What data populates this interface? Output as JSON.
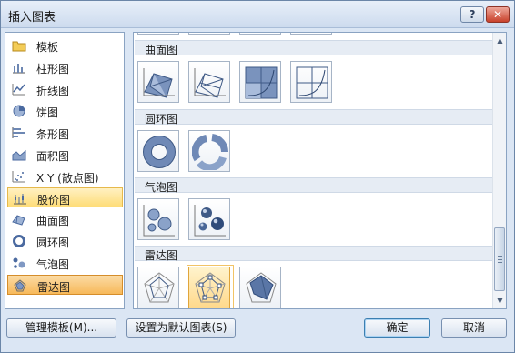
{
  "dialog": {
    "title": "插入图表",
    "help_label": "?",
    "close_label": "✕"
  },
  "categories": [
    {
      "label": "模板",
      "icon": "folder-icon"
    },
    {
      "label": "柱形图",
      "icon": "column-chart-icon"
    },
    {
      "label": "折线图",
      "icon": "line-chart-icon"
    },
    {
      "label": "饼图",
      "icon": "pie-chart-icon"
    },
    {
      "label": "条形图",
      "icon": "bar-chart-icon"
    },
    {
      "label": "面积图",
      "icon": "area-chart-icon"
    },
    {
      "label": "X Y (散点图)",
      "icon": "scatter-chart-icon"
    },
    {
      "label": "股价图",
      "icon": "stock-chart-icon",
      "state": "hover"
    },
    {
      "label": "曲面图",
      "icon": "surface-chart-icon"
    },
    {
      "label": "圆环图",
      "icon": "doughnut-chart-icon"
    },
    {
      "label": "气泡图",
      "icon": "bubble-chart-icon"
    },
    {
      "label": "雷达图",
      "icon": "radar-chart-icon",
      "state": "selected"
    }
  ],
  "sections": [
    {
      "label": "曲面图",
      "thumbs": [
        "3d-surface-icon",
        "wireframe-3d-surface-icon",
        "contour-icon",
        "wireframe-contour-icon"
      ]
    },
    {
      "label": "圆环图",
      "thumbs": [
        "doughnut-icon",
        "exploded-doughnut-icon"
      ]
    },
    {
      "label": "气泡图",
      "thumbs": [
        "bubble-icon",
        "3d-bubble-icon"
      ]
    },
    {
      "label": "雷达图",
      "thumbs": [
        "radar-icon",
        "radar-with-markers-icon",
        "filled-radar-icon"
      ],
      "selected_index": 1
    }
  ],
  "buttons": {
    "manage_templates": "管理模板(M)...",
    "set_default": "设置为默认图表(S)",
    "ok": "确定",
    "cancel": "取消"
  },
  "scrollbar": {
    "up": "▲",
    "down": "▼"
  },
  "colors": {
    "selected_bg": "#fedd78",
    "selected_border": "#e6b94c",
    "section_bg": "#e6ecf4",
    "pane_border": "#8aa3c2"
  }
}
